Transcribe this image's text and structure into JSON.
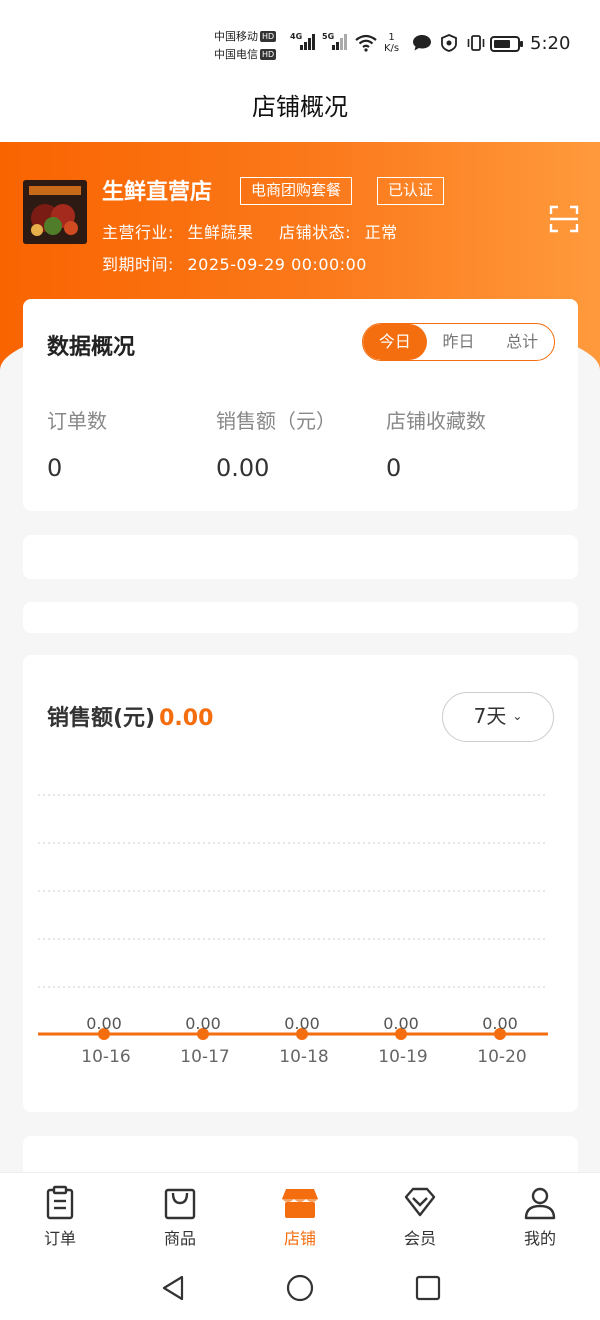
{
  "status_bar": {
    "carrier1": "中国移动",
    "carrier2": "中国电信",
    "hd": "HD",
    "net1": "4G",
    "net2": "5G",
    "speed_value": "1",
    "speed_unit": "K/s",
    "time": "5:20"
  },
  "page_title": "店铺概况",
  "shop": {
    "name": "生鲜直营店",
    "badge_plan": "电商团购套餐",
    "badge_verified": "已认证",
    "industry_label": "主营行业:",
    "industry_value": "生鲜蔬果",
    "status_label": "店铺状态:",
    "status_value": "正常",
    "expiry_label": "到期时间:",
    "expiry_value": "2025-09-29 00:00:00"
  },
  "overview": {
    "title": "数据概况",
    "tabs": [
      "今日",
      "昨日",
      "总计"
    ],
    "active_tab": 0,
    "stats": [
      {
        "label": "订单数",
        "value": "0"
      },
      {
        "label": "销售额（元）",
        "value": "0.00"
      },
      {
        "label": "店铺收藏数",
        "value": "0"
      }
    ]
  },
  "sales": {
    "title": "销售额(元)",
    "total": "0.00",
    "range": "7天"
  },
  "chart_data": {
    "type": "line",
    "categories": [
      "10-16",
      "10-17",
      "10-18",
      "10-19",
      "10-20"
    ],
    "values": [
      0,
      0,
      0,
      0,
      0
    ],
    "value_labels": [
      "0.00",
      "0.00",
      "0.00",
      "0.00",
      "0.00"
    ],
    "grid": true,
    "color": "#f46d0e"
  },
  "tabbar": {
    "items": [
      {
        "label": "订单",
        "icon": "clipboard-icon"
      },
      {
        "label": "商品",
        "icon": "shopping-bag-icon"
      },
      {
        "label": "店铺",
        "icon": "store-icon"
      },
      {
        "label": "会员",
        "icon": "diamond-icon"
      },
      {
        "label": "我的",
        "icon": "person-icon"
      }
    ],
    "active": 2
  },
  "colors": {
    "accent": "#f46d0e",
    "header_start": "#f96400",
    "header_end": "#ff9a3c"
  }
}
